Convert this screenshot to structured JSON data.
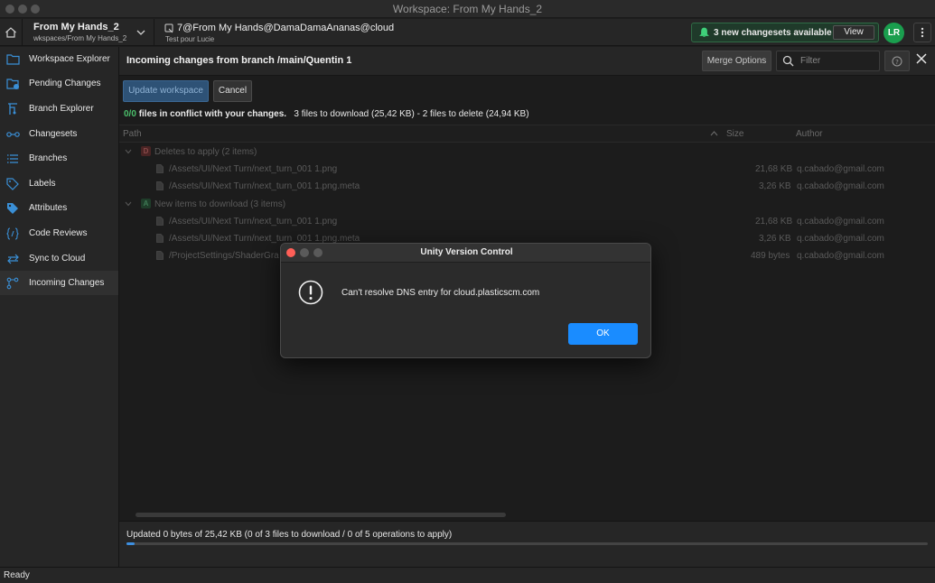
{
  "window": {
    "title": "Workspace: From My Hands_2"
  },
  "workspace": {
    "name": "From My Hands_2",
    "path": "wkspaces/From My Hands_2",
    "branch": "7@From My Hands@DamaDamaAnanas@cloud",
    "branch_comment": "Test pour Lucie"
  },
  "notification": {
    "text": "3 new changesets available",
    "view_label": "View",
    "accent": "#2f6b45"
  },
  "user": {
    "initials": "LR",
    "avatar_color": "#1a9e4e"
  },
  "sidebar": {
    "items": [
      {
        "label": "Workspace Explorer",
        "icon": "folder-icon"
      },
      {
        "label": "Pending Changes",
        "icon": "pending-changes-icon"
      },
      {
        "label": "Branch Explorer",
        "icon": "branch-explorer-icon"
      },
      {
        "label": "Changesets",
        "icon": "changesets-icon"
      },
      {
        "label": "Branches",
        "icon": "branches-list-icon"
      },
      {
        "label": "Labels",
        "icon": "label-tag-icon"
      },
      {
        "label": "Attributes",
        "icon": "attributes-tag-icon"
      },
      {
        "label": "Code Reviews",
        "icon": "code-review-icon"
      },
      {
        "label": "Sync to Cloud",
        "icon": "sync-icon"
      },
      {
        "label": "Incoming Changes",
        "icon": "incoming-changes-icon"
      }
    ],
    "active_index": 9
  },
  "main": {
    "heading": "Incoming changes from branch /main/Quentin 1",
    "merge_options": "Merge Options",
    "filter_placeholder": "Filter",
    "update_label": "Update workspace",
    "cancel_label": "Cancel",
    "summary": {
      "conflicts": "0/0",
      "conflict_text": "files in conflict with your changes.",
      "counts": "3 files to download (25,42 KB) - 2 files to delete (24,94 KB)"
    },
    "columns": {
      "path": "Path",
      "size": "Size",
      "author": "Author"
    },
    "groups": [
      {
        "badge": "D",
        "badge_color": "#a83232",
        "title": "Deletes to apply (2 items)",
        "items": [
          {
            "path": "/Assets/UI/Next Turn/next_turn_001 1.png",
            "size": "21,68 KB",
            "author": "q.cabado@gmail.com"
          },
          {
            "path": "/Assets/UI/Next Turn/next_turn_001 1.png.meta",
            "size": "3,26 KB",
            "author": "q.cabado@gmail.com"
          }
        ]
      },
      {
        "badge": "A",
        "badge_color": "#2d8a4e",
        "title": "New items to download (3 items)",
        "items": [
          {
            "path": "/Assets/UI/Next Turn/next_turn_001 1.png",
            "size": "21,68 KB",
            "author": "q.cabado@gmail.com"
          },
          {
            "path": "/Assets/UI/Next Turn/next_turn_001 1.png.meta",
            "size": "3,26 KB",
            "author": "q.cabado@gmail.com"
          },
          {
            "path": "/ProjectSettings/ShaderGra",
            "size": "489 bytes",
            "author": "q.cabado@gmail.com"
          }
        ]
      }
    ],
    "progress_text": "Updated 0 bytes of 25,42 KB (0 of 3 files to download / 0 of 5 operations to apply)",
    "progress_fraction": 0.01
  },
  "statusbar": {
    "text": "Ready"
  },
  "dialog": {
    "title": "Unity Version Control",
    "message": "Can't resolve DNS entry for cloud.plasticscm.com",
    "ok_label": "OK",
    "icon": "warning-icon"
  }
}
